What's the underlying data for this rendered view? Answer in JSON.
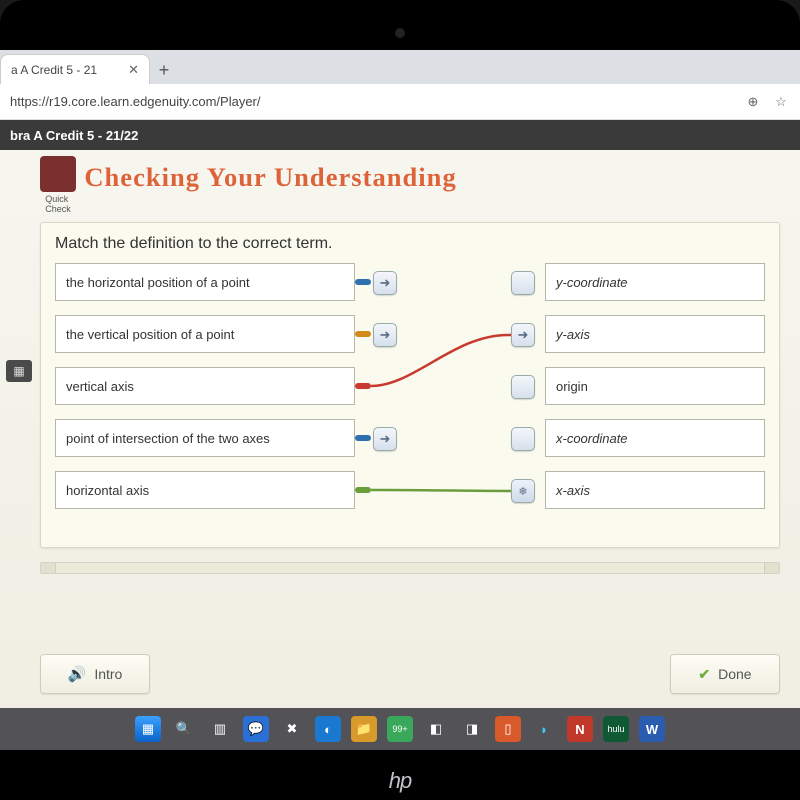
{
  "browser": {
    "tab_title": "a A Credit 5 - 21",
    "url": "https://r19.core.learn.edgenuity.com/Player/"
  },
  "course_bar": "bra A Credit 5 - 21/22",
  "quick_check_label": "Quick\nCheck",
  "page_title": "Checking Your Understanding",
  "instruction": "Match the definition to the correct term.",
  "definitions": [
    "the horizontal position of a point",
    "the vertical position of a point",
    "vertical axis",
    "point of intersection of the two axes",
    "horizontal axis"
  ],
  "terms": [
    "y-coordinate",
    "y-axis",
    "origin",
    "x-coordinate",
    "x-axis"
  ],
  "connector_colors": {
    "def0": "#2e6fb0",
    "def1": "#d38a1a",
    "def2": "#c73a2d",
    "def3": "#2e6fb0",
    "def4": "#6a9e3b"
  },
  "buttons": {
    "intro": "Intro",
    "done": "Done"
  },
  "taskbar_badge": "99+",
  "logo": "hp"
}
